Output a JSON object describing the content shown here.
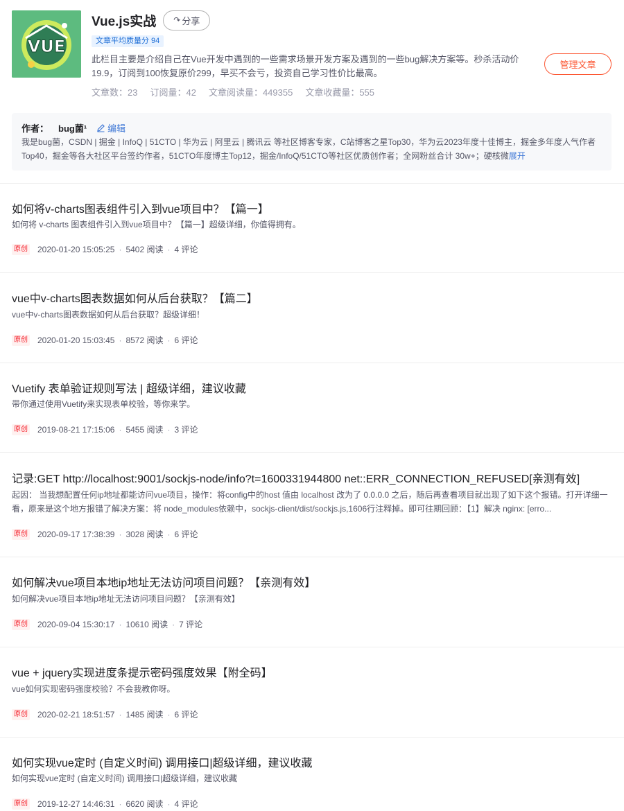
{
  "column": {
    "title": "Vue.js实战",
    "share_label": "分享",
    "quality_badge": "文章平均质量分 94",
    "description": "此栏目主要是介绍自己在Vue开发中遇到的一些需求场景开发方案及遇到的一些bug解决方案等。秒杀活动价19.9，订阅到100恢复原价299，早买不会亏，投资自己学习性价比最高。",
    "stats": [
      "文章数：23",
      "订阅量：42",
      "文章阅读量：449355",
      "文章收藏量：555"
    ],
    "manage_label": "管理文章",
    "cover_text": "VUE"
  },
  "author": {
    "label": "作者：",
    "name": "bug菌¹",
    "edit_label": "编辑",
    "bio": "我是bug菌，CSDN | 掘金 | InfoQ | 51CTO | 华为云 | 阿里云 | 腾讯云 等社区博客专家，C站博客之星Top30，华为云2023年度十佳博主，掘金多年度人气作者Top40，掘金等各大社区平台签约作者，51CTO年度博主Top12，掘金/InfoQ/51CTO等社区优质创作者；全网粉丝合计 30w+；硬核微",
    "expand_label": "展开"
  },
  "articles": [
    {
      "title": "如何将v-charts图表组件引入到vue项目中？【篇一】",
      "summary": "如何将 v-charts 图表组件引入到vue项目中？【篇一】超级详细，你值得拥有。",
      "tag": "原创",
      "date": "2020-01-20 15:05:25",
      "reads": "5402 阅读",
      "comments": "4 评论"
    },
    {
      "title": "vue中v-charts图表数据如何从后台获取？【篇二】",
      "summary": "vue中v-charts图表数据如何从后台获取？超级详细！",
      "tag": "原创",
      "date": "2020-01-20 15:03:45",
      "reads": "8572 阅读",
      "comments": "6 评论"
    },
    {
      "title": "Vuetify 表单验证规则写法 | 超级详细，建议收藏",
      "summary": "带你通过使用Vuetify来实现表单校验，等你来学。",
      "tag": "原创",
      "date": "2019-08-21 17:15:06",
      "reads": "5455 阅读",
      "comments": "3 评论"
    },
    {
      "title": "记录:GET http://localhost:9001/sockjs-node/info?t=1600331944800 net::ERR_CONNECTION_REFUSED[亲测有效]",
      "summary": "起因：  当我想配置任何ip地址都能访问vue项目，操作：将config中的host 值由 localhost 改为了 0.0.0.0 之后，随后再查看项目就出现了如下这个报错。打开详细一看，原来是这个地方报错了解决方案：将 node_modules依赖中，sockjs-client/dist/sockjs.js,1606行注释掉。即可往期回顾：【1】解决 nginx: [erro...",
      "tag": "原创",
      "date": "2020-09-17 17:38:39",
      "reads": "3028 阅读",
      "comments": "6 评论"
    },
    {
      "title": "如何解决vue项目本地ip地址无法访问项目问题？【亲测有效】",
      "summary": "如何解决vue项目本地ip地址无法访问项目问题？【亲测有效】",
      "tag": "原创",
      "date": "2020-09-04 15:30:17",
      "reads": "10610 阅读",
      "comments": "7 评论"
    },
    {
      "title": "vue + jquery实现进度条提示密码强度效果【附全码】",
      "summary": "vue如何实现密码强度校验？不会我教你呀。",
      "tag": "原创",
      "date": "2020-02-21 18:51:57",
      "reads": "1485 阅读",
      "comments": "6 评论"
    },
    {
      "title": "如何实现vue定时 (自定义时间) 调用接口|超级详细，建议收藏",
      "summary": "如何实现vue定时 (自定义时间) 调用接口|超级详细，建议收藏",
      "tag": "原创",
      "date": "2019-12-27 14:46:31",
      "reads": "6620 阅读",
      "comments": "4 评论"
    }
  ],
  "colors": {
    "accent": "#fc5531",
    "link": "#3e77d6",
    "badge_bg": "#e8f2ff",
    "tag_red": "#f5222d"
  }
}
